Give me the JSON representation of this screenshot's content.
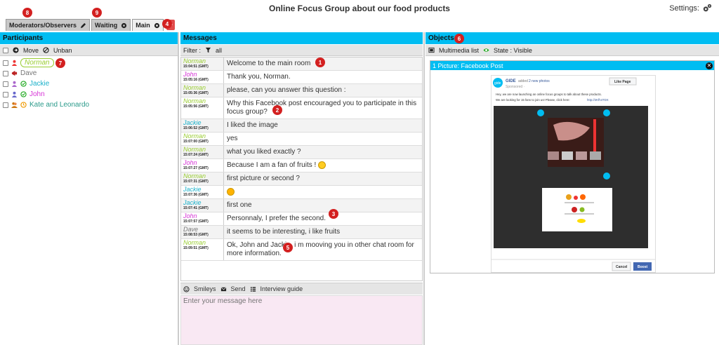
{
  "header": {
    "title": "Online Focus Group about our food products",
    "settings_label": "Settings:"
  },
  "tabs": [
    {
      "label": "Moderators/Observers",
      "icon": "pencil-icon"
    },
    {
      "label": "Waiting",
      "icon": "gear-icon"
    },
    {
      "label": "Main",
      "icon": "gear-icon"
    }
  ],
  "tab_add_label": "+",
  "badges": [
    "1",
    "2",
    "3",
    "4",
    "5",
    "6",
    "7",
    "8",
    "9"
  ],
  "participants": {
    "title": "Participants",
    "actions": {
      "move": "Move",
      "unban": "Unban"
    },
    "items": [
      {
        "name": "Norman",
        "color": "#9acd32",
        "boxed": true,
        "status": "none"
      },
      {
        "name": "Dave",
        "color": "#777777",
        "boxed": false,
        "status": "none"
      },
      {
        "name": "Jackie",
        "color": "#1ab0c9",
        "boxed": false,
        "status": "online"
      },
      {
        "name": "John",
        "color": "#d633d6",
        "boxed": false,
        "status": "online"
      },
      {
        "name": "Kate and Leonardo",
        "color": "#2a9a8a",
        "boxed": false,
        "status": "away"
      }
    ]
  },
  "messages": {
    "title": "Messages",
    "filter_label": "Filter :",
    "filter_value": "all",
    "items": [
      {
        "author": "Norman",
        "color": "#9acd32",
        "time": "15:04:51 (GMT)",
        "text": "Welcome to the main room"
      },
      {
        "author": "John",
        "color": "#d633d6",
        "time": "15:05:16 (GMT)",
        "text": "Thank you, Norman."
      },
      {
        "author": "Norman",
        "color": "#9acd32",
        "time": "15:05:36 (GMT)",
        "text": "please, can you answer this question :"
      },
      {
        "author": "Norman",
        "color": "#9acd32",
        "time": "15:05:56 (GMT)",
        "text": "Why this Facebook post encouraged you to participate in this focus group?"
      },
      {
        "author": "Jackie",
        "color": "#1ab0c9",
        "time": "15:06:52 (GMT)",
        "text": "I liked the image"
      },
      {
        "author": "Norman",
        "color": "#9acd32",
        "time": "15:07:00 (GMT)",
        "text": "yes"
      },
      {
        "author": "Norman",
        "color": "#9acd32",
        "time": "15:07:24 (GMT)",
        "text": "what you liked exactly ?"
      },
      {
        "author": "John",
        "color": "#d633d6",
        "time": "15:07:27 (GMT)",
        "text": "Because I am a fan of fruits !"
      },
      {
        "author": "Norman",
        "color": "#9acd32",
        "time": "15:07:31 (GMT)",
        "text": "first picture or second ?"
      },
      {
        "author": "Jackie",
        "color": "#1ab0c9",
        "time": "15:07:36 (GMT)",
        "text": ""
      },
      {
        "author": "Jackie",
        "color": "#1ab0c9",
        "time": "15:07:41 (GMT)",
        "text": "first one"
      },
      {
        "author": "John",
        "color": "#d633d6",
        "time": "15:07:57 (GMT)",
        "text": "Personnaly, I prefer the second."
      },
      {
        "author": "Dave",
        "color": "#777777",
        "time": "15:08:53 (GMT)",
        "text": "it seems to be interesting, i like fruits"
      },
      {
        "author": "Norman",
        "color": "#9acd32",
        "time": "15:09:51 (GMT)",
        "text": "Ok, John and Jackie, i m mooving you in other chat room for more information."
      }
    ],
    "toolbar": {
      "smileys": "Smileys",
      "send": "Send",
      "guide": "Interview guide"
    },
    "placeholder": "Enter your message here"
  },
  "objects": {
    "title": "Objects",
    "multimedia_label": "Multimedia list",
    "state_label": "State : Visible",
    "card_title": "1 Picture: Facebook Post",
    "fb": {
      "brand": "GIDE",
      "added": "added",
      "photos": "2 new photos",
      "sponsored": "Sponsored ·",
      "like_btn": "Like Page",
      "text1": "Hey, we are now launching an online focus groups to talk about these products.",
      "text2": "We are looking for 15 fans to join us! Please, click here:",
      "link": "http://2Kfh4TDX",
      "cancel": "Cancel",
      "boost": "Boost"
    }
  }
}
